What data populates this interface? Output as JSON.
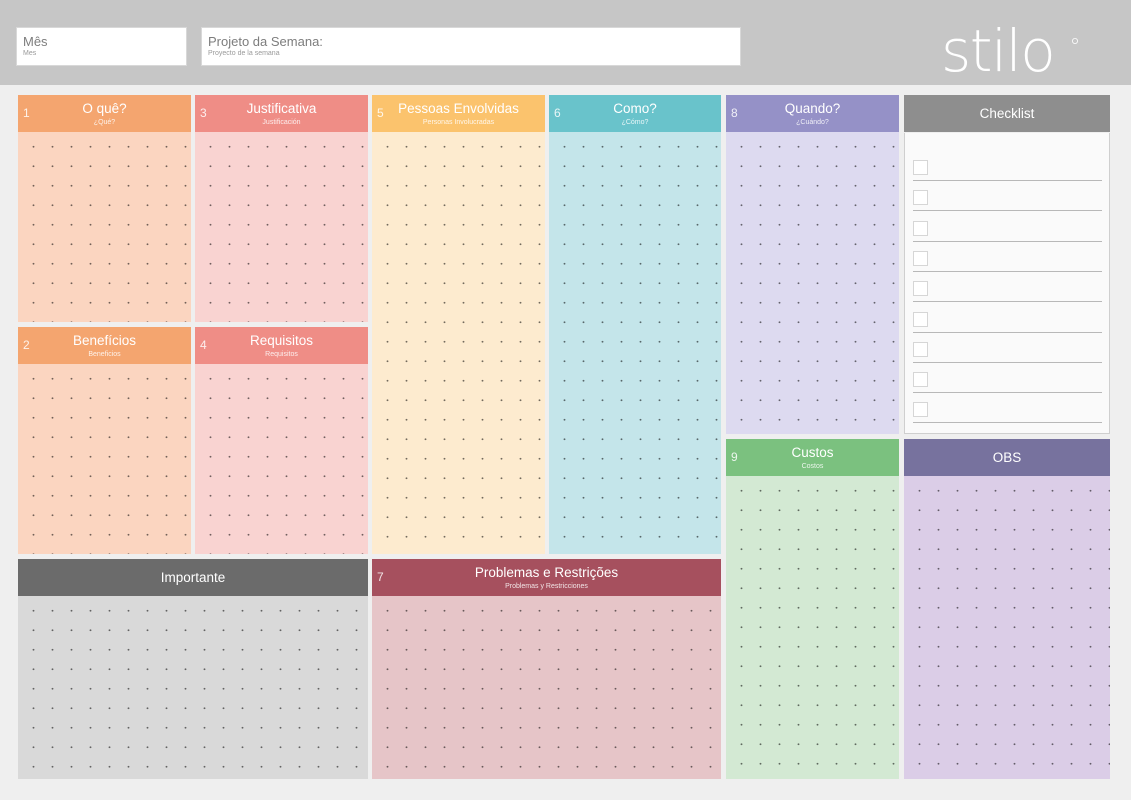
{
  "header": {
    "month": {
      "label": "Mês",
      "sublabel": "Mes"
    },
    "project": {
      "label": "Projeto da Semana:",
      "sublabel": "Proyecto de la semana"
    },
    "logo_text": "stilo"
  },
  "panels": {
    "oque": {
      "number": "1",
      "title": "O quê?",
      "subtitle": "¿Qué?",
      "color": "#f4a56f",
      "fill": "#fbd5c0"
    },
    "beneficios": {
      "number": "2",
      "title": "Benefícios",
      "subtitle": "Beneficios",
      "color": "#f4a56f",
      "fill": "#fbd5c0"
    },
    "justificativa": {
      "number": "3",
      "title": "Justificativa",
      "subtitle": "Justificación",
      "color": "#ef8d86",
      "fill": "#f9d3d1"
    },
    "requisitos": {
      "number": "4",
      "title": "Requisitos",
      "subtitle": "Requisitos",
      "color": "#ef8d86",
      "fill": "#f9d3d1"
    },
    "pessoas": {
      "number": "5",
      "title": "Pessoas Envolvidas",
      "subtitle": "Personas Involucradas",
      "color": "#fbc36d",
      "fill": "#fdebcf"
    },
    "como": {
      "number": "6",
      "title": "Como?",
      "subtitle": "¿Cómo?",
      "color": "#69c3cb",
      "fill": "#c4e5ea"
    },
    "problemas": {
      "number": "7",
      "title": "Problemas e Restrições",
      "subtitle": "Problemas y Restricciones",
      "color": "#a6505e",
      "fill": "#e6c5c8"
    },
    "quando": {
      "number": "8",
      "title": "Quando?",
      "subtitle": "¿Cuándo?",
      "color": "#9591c7",
      "fill": "#dddaf0"
    },
    "custos": {
      "number": "9",
      "title": "Custos",
      "subtitle": "Costos",
      "color": "#7bc17f",
      "fill": "#d3e9d3"
    },
    "checklist": {
      "title": "Checklist",
      "color": "#8e8e8e",
      "rows": 9
    },
    "importante": {
      "title": "Importante",
      "color": "#6b6b6b",
      "fill": "#d9d9d9"
    },
    "obs": {
      "title": "OBS",
      "color": "#77729e",
      "fill": "#dbcde7"
    }
  }
}
